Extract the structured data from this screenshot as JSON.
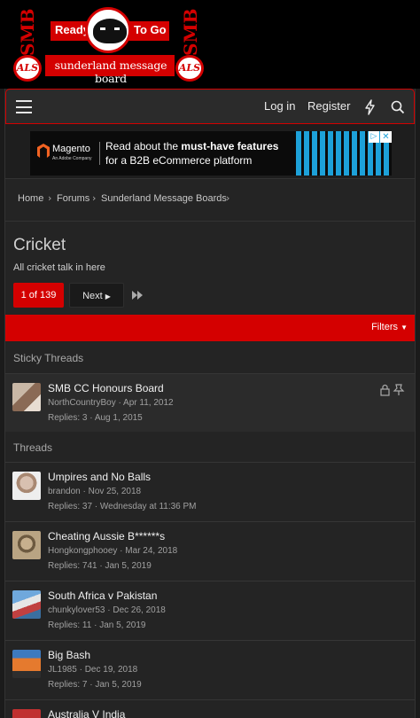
{
  "banner": {
    "smb_text": "SMB",
    "als_text": "ALS",
    "ready_left": "Ready",
    "ready_right": "To Go",
    "subtitle": "sunderland message board"
  },
  "nav": {
    "login": "Log in",
    "register": "Register"
  },
  "ad": {
    "logo": "Magento",
    "logo_sub": "An Adobe Company",
    "line1_pre": "Read about the ",
    "line1_bold": "must-have features",
    "line2": "for a B2B eCommerce platform",
    "close": "✕",
    "info": "▷"
  },
  "breadcrumb": {
    "items": [
      "Home",
      "Forums",
      "Sunderland Message Boards"
    ]
  },
  "forum": {
    "title": "Cricket",
    "description": "All cricket talk in here"
  },
  "pager": {
    "current": "1 of 139",
    "next": "Next"
  },
  "filters": "Filters",
  "sections": {
    "sticky": "Sticky Threads",
    "threads": "Threads"
  },
  "sticky_threads": [
    {
      "title": "SMB CC Honours Board",
      "author": "NorthCountryBoy",
      "date": "Apr 11, 2012",
      "replies": "Replies: 3",
      "last": "Aug 1, 2015"
    }
  ],
  "threads": [
    {
      "title": "Umpires and No Balls",
      "author": "brandon",
      "date": "Nov 25, 2018",
      "replies": "Replies: 37",
      "last": "Wednesday at 11:36 PM"
    },
    {
      "title": "Cheating Aussie B******s",
      "author": "Hongkongphooey",
      "date": "Mar 24, 2018",
      "replies": "Replies: 741",
      "last": "Jan 5, 2019"
    },
    {
      "title": "South Africa v Pakistan",
      "author": "chunkylover53",
      "date": "Dec 26, 2018",
      "replies": "Replies: 11",
      "last": "Jan 5, 2019"
    },
    {
      "title": "Big Bash",
      "author": "JL1985",
      "date": "Dec 19, 2018",
      "replies": "Replies: 7",
      "last": "Jan 5, 2019"
    },
    {
      "title": "Australia V India",
      "author": "",
      "date": "",
      "replies": "",
      "last": ""
    }
  ],
  "colors": {
    "accent": "#d40000",
    "background": "#1b1b1b",
    "panel": "#242424"
  }
}
